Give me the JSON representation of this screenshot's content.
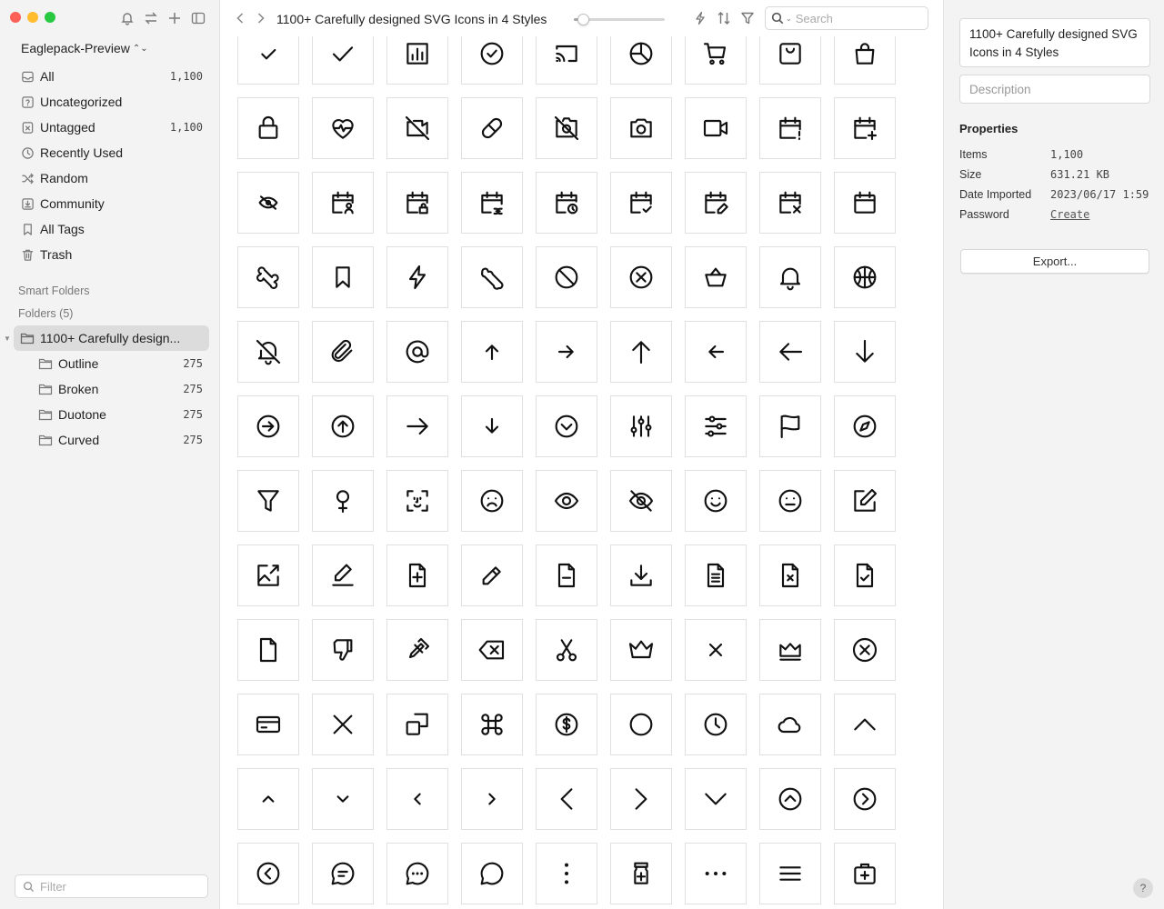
{
  "window": {
    "traffic_colors": [
      "#fe5f57",
      "#febc2e",
      "#28c840"
    ]
  },
  "sidebar": {
    "library_name": "Eaglepack-Preview",
    "library_toggle_glyph": "⌃⌄",
    "tools": [
      "bell-icon",
      "swap-icon",
      "plus-icon",
      "sidebar-toggle-icon"
    ],
    "items": [
      {
        "label": "All",
        "count": "1,100",
        "icon": "inbox-icon"
      },
      {
        "label": "Uncategorized",
        "count": "",
        "icon": "question-box-icon"
      },
      {
        "label": "Untagged",
        "count": "1,100",
        "icon": "tag-x-icon"
      },
      {
        "label": "Recently Used",
        "count": "",
        "icon": "clock-icon"
      },
      {
        "label": "Random",
        "count": "",
        "icon": "shuffle-icon"
      },
      {
        "label": "Community",
        "count": "",
        "icon": "download-box-icon"
      },
      {
        "label": "All Tags",
        "count": "",
        "icon": "bookmark-icon"
      },
      {
        "label": "Trash",
        "count": "",
        "icon": "trash-icon"
      }
    ],
    "smart_folders_label": "Smart Folders",
    "folders_label": "Folders (5)",
    "root_folder": "1100+ Carefully design...",
    "subfolders": [
      {
        "label": "Outline",
        "count": "275"
      },
      {
        "label": "Broken",
        "count": "275"
      },
      {
        "label": "Duotone",
        "count": "275"
      },
      {
        "label": "Curved",
        "count": "275"
      }
    ],
    "filter_placeholder": "Filter"
  },
  "toolbar": {
    "title": "1100+ Carefully designed SVG Icons in 4 Styles",
    "zoom_level": 0.05,
    "search_placeholder": "Search"
  },
  "grid": {
    "icons": [
      "check-icon",
      "check-large-icon",
      "chart-bar-box-icon",
      "check-circle-icon",
      "cast-icon",
      "pie-chart-icon",
      "cart-icon",
      "shopping-bag-box-icon",
      "shopping-bag-icon",
      "lock-bag-icon",
      "heart-pulse-icon",
      "camera-off-icon",
      "capsule-icon",
      "camera-slash-icon",
      "camera-icon",
      "video-camera-icon",
      "calendar-alert-icon",
      "calendar-add-icon",
      "eye-slash-small-icon",
      "calendar-user-icon",
      "calendar-lock-icon",
      "calendar-link-icon",
      "calendar-clock-icon",
      "calendar-check-icon",
      "calendar-edit-icon",
      "calendar-remove-icon",
      "calendar-icon",
      "bone-tilted-icon",
      "bookmark-icon",
      "bolt-icon",
      "bone-icon",
      "block-icon",
      "close-circle-icon",
      "basket-icon",
      "bell-icon",
      "basketball-icon",
      "bell-off-icon",
      "paperclip-icon",
      "at-sign-icon",
      "arrow-up-small-icon",
      "arrow-right-small-icon",
      "arrow-up-icon",
      "arrow-left-small-icon",
      "arrow-left-icon",
      "arrow-down-icon",
      "arrow-right-circle-icon",
      "arrow-up-circle-icon",
      "arrow-right-icon",
      "arrow-down-small-icon",
      "chevron-down-circle-icon",
      "sliders-vertical-icon",
      "sliders-horizontal-icon",
      "flag-icon",
      "compass-icon",
      "filter-icon",
      "female-icon",
      "face-scan-icon",
      "face-sad-icon",
      "eye-icon",
      "eye-off-icon",
      "face-smile-icon",
      "face-neutral-icon",
      "edit-box-icon",
      "image-edit-icon",
      "pencil-line-icon",
      "document-add-icon",
      "pencil-icon",
      "document-icon",
      "download-icon",
      "document-text-icon",
      "document-remove-icon",
      "document-check-icon",
      "document-blank-icon",
      "thumbs-down-icon",
      "broken-pencil-icon",
      "backspace-icon",
      "scissors-icon",
      "crown-icon",
      "close-small-icon",
      "crown-box-icon",
      "close-circle-large-icon",
      "credit-card-icon",
      "close-large-icon",
      "copy-icon",
      "command-icon",
      "dollar-circle-icon",
      "circle-icon",
      "clock-icon",
      "cloud-icon",
      "chevron-up-large-icon",
      "chevron-up-icon",
      "chevron-down-icon",
      "chevron-left-icon",
      "chevron-right-icon",
      "chevron-left-large-icon",
      "chevron-right-large-icon",
      "chevron-down-large-icon",
      "chevron-up-circle-icon",
      "chevron-right-circle-icon",
      "chevron-left-circle-icon",
      "chat-lines-icon",
      "chat-dots-icon",
      "chat-icon",
      "more-vertical-icon",
      "medicine-bottle-icon",
      "more-horizontal-icon",
      "menu-icon",
      "first-aid-kit-icon"
    ]
  },
  "inspector": {
    "title": "1100+ Carefully designed SVG Icons in 4 Styles",
    "description_placeholder": "Description",
    "properties_label": "Properties",
    "properties": [
      {
        "key": "Items",
        "value": "1,100"
      },
      {
        "key": "Size",
        "value": "631.21 KB"
      },
      {
        "key": "Date Imported",
        "value": "2023/06/17 1:59"
      },
      {
        "key": "Password",
        "value": "Create"
      }
    ],
    "export_label": "Export...",
    "help_label": "?"
  }
}
